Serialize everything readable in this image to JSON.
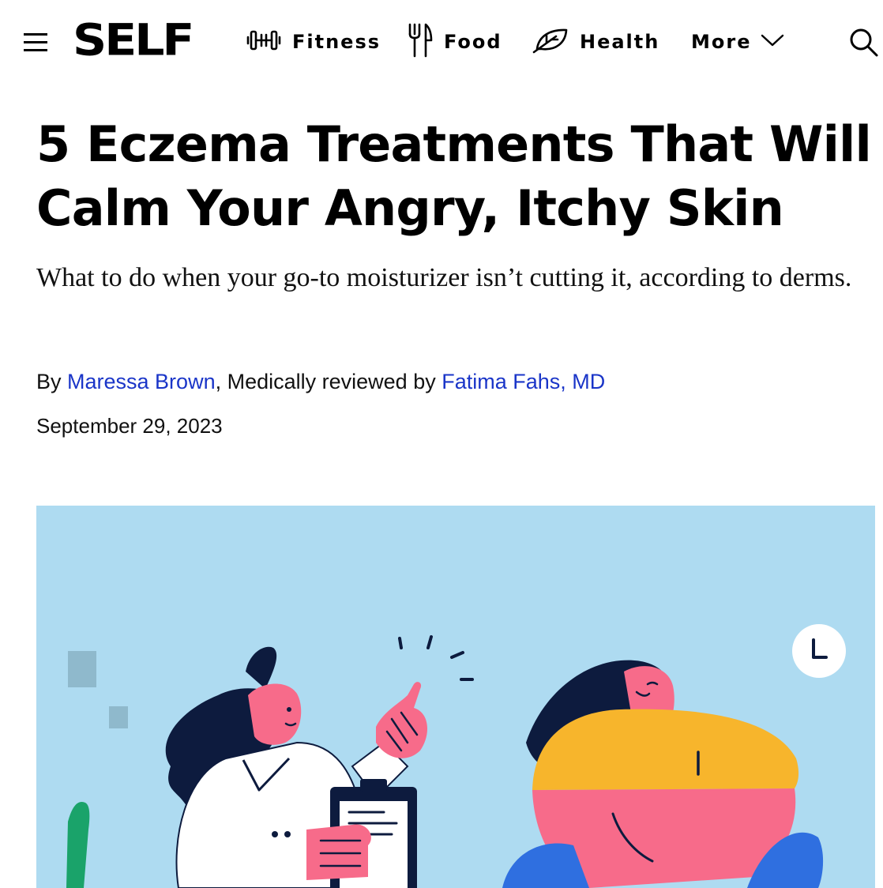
{
  "header": {
    "logo": "SELF",
    "nav": [
      {
        "label": "Fitness",
        "icon": "dumbbell-icon"
      },
      {
        "label": "Food",
        "icon": "fork-knife-icon"
      },
      {
        "label": "Health",
        "icon": "leaf-icon"
      },
      {
        "label": "More",
        "icon": "chevron-down-icon"
      }
    ],
    "menu_icon": "hamburger-menu-icon",
    "search_icon": "search-icon"
  },
  "article": {
    "headline_line1": "5 Eczema Treatments That Will",
    "headline_line2": "Calm Your Angry, Itchy Skin",
    "dek": "What to do when your go-to moisturizer isn’t cutting it, according to derms.",
    "byline_prefix": "By ",
    "author": "Maressa Brown",
    "reviewed_prefix": ", Medically reviewed by ",
    "reviewer": "Fatima Fahs, MD",
    "date": "September 29, 2023"
  },
  "hero": {
    "description_icon": "doctor-patient-illustration",
    "colors": {
      "background": "#aedbf1",
      "pink": "#f76b8a",
      "yellow": "#f7b52c",
      "navy": "#0d1b3e",
      "blue": "#2f6fe0",
      "green": "#1aa36a"
    }
  },
  "colors": {
    "link": "#1a35c8",
    "text": "#000000"
  }
}
